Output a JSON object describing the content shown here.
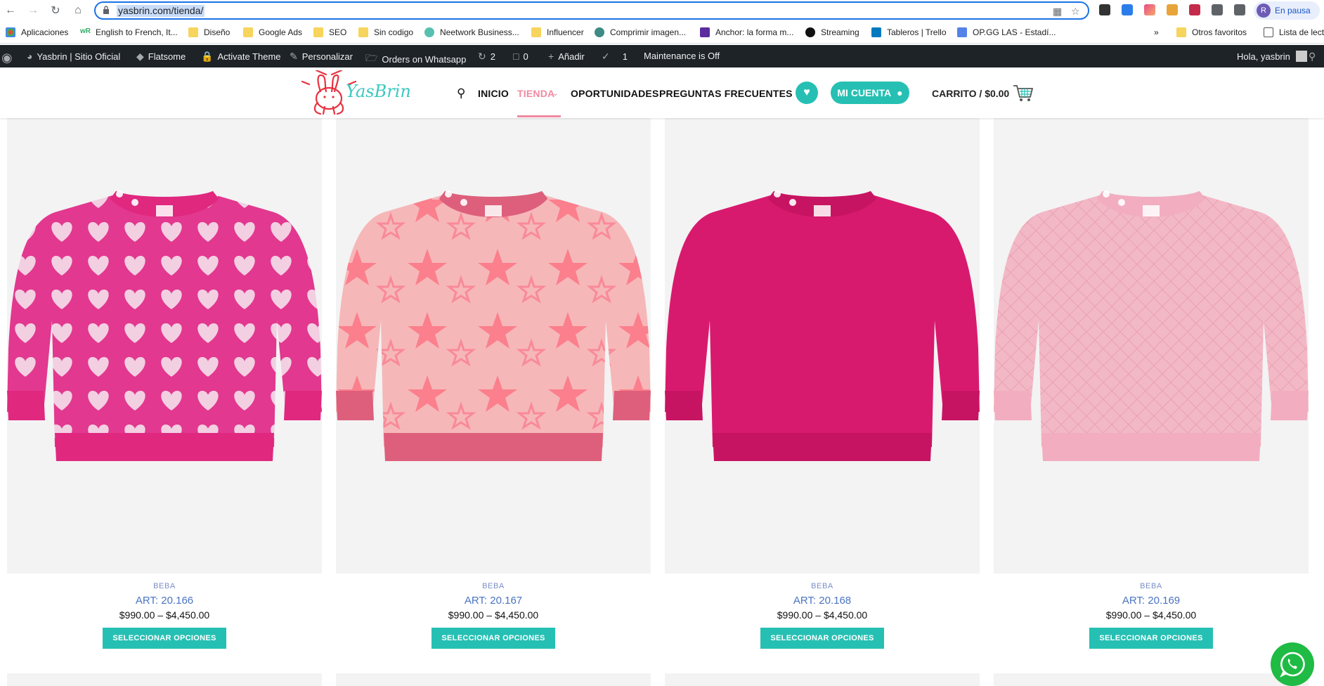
{
  "browser": {
    "url": "yasbrin.com/tienda/",
    "profile_label": "En pausa",
    "profile_initial": "R",
    "bookmarks": [
      "Aplicaciones",
      "English to French, It...",
      "Diseño",
      "Google Ads",
      "SEO",
      "Sin codigo",
      "Neetwork Business...",
      "Influencer",
      "Comprimir imagen...",
      "Anchor: la forma m...",
      "Streaming",
      "Tableros | Trello",
      "OP.GG LAS - Estadí...",
      "»",
      "Otros favoritos",
      "Lista de lect"
    ]
  },
  "wpbar": {
    "site_name": "Yasbrin | Sitio Oficial",
    "theme": "Flatsome",
    "activate": "Activate Theme",
    "customize": "Personalizar",
    "orders": "Orders on Whatsapp",
    "updates_count": "2",
    "comments_count": "0",
    "add_new": "Añadir",
    "yoast_count": "1",
    "maintenance": "Maintenance is Off",
    "greeting": "Hola, yasbrin"
  },
  "site": {
    "logo_text": "YasBrin",
    "menu": [
      "INICIO",
      "TIENDA",
      "OPORTUNIDADES",
      "PREGUNTAS FRECUENTES"
    ],
    "account_label": "MI CUENTA",
    "cart_label": "CARRITO / $0.00"
  },
  "products": [
    {
      "category": "BEBA",
      "title": "ART: 20.166",
      "price": "$990.00 – $4,450.00",
      "button": "SELECCIONAR OPCIONES",
      "pattern": "hearts",
      "base_color": "#e2388f",
      "rib_color": "#e0287f"
    },
    {
      "category": "BEBA",
      "title": "ART: 20.167",
      "price": "$990.00 – $4,450.00",
      "button": "SELECCIONAR OPCIONES",
      "pattern": "stars",
      "base_color": "#f6b7b9",
      "rib_color": "#dd5f7c"
    },
    {
      "category": "BEBA",
      "title": "ART: 20.168",
      "price": "$990.00 – $4,450.00",
      "button": "SELECCIONAR OPCIONES",
      "pattern": "plain",
      "base_color": "#d81a6e",
      "rib_color": "#c71462"
    },
    {
      "category": "BEBA",
      "title": "ART: 20.169",
      "price": "$990.00 – $4,450.00",
      "button": "SELECCIONAR OPCIONES",
      "pattern": "quilted",
      "base_color": "#f3b8c6",
      "rib_color": "#f2adc0"
    }
  ],
  "colors": {
    "accent": "#25c0b3",
    "menu_active": "#f08aa0",
    "wp_bar": "#1d2327",
    "whatsapp": "#1fbb44"
  }
}
